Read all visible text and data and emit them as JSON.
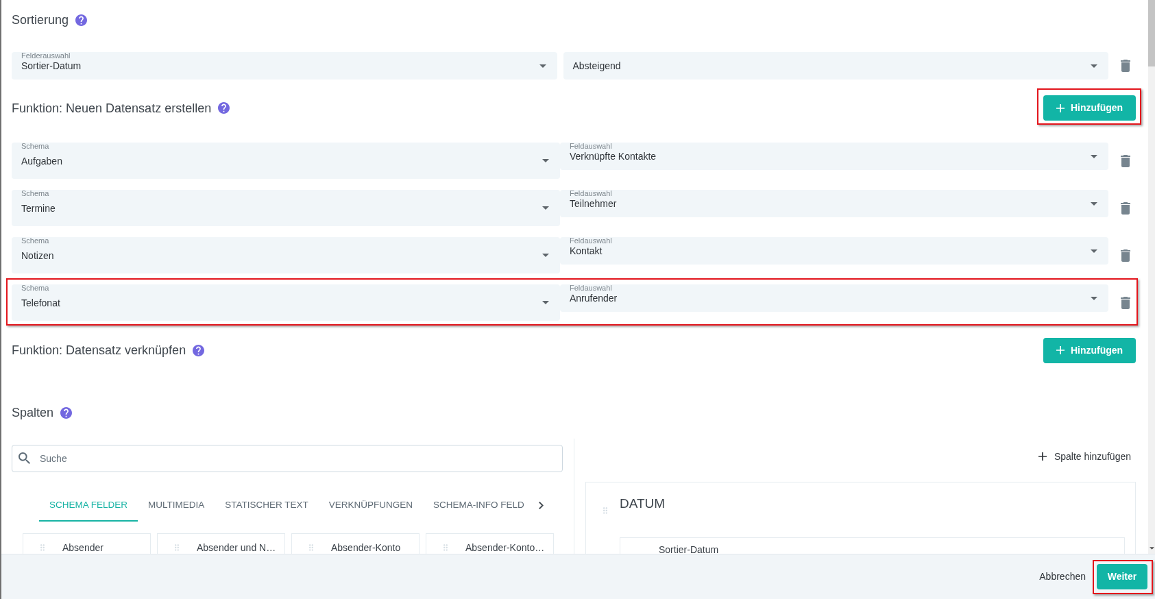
{
  "sorting": {
    "title": "Sortierung",
    "field": {
      "label": "Felderauswahl",
      "value": "Sortier-Datum"
    },
    "order": {
      "value": "Absteigend"
    }
  },
  "create_function": {
    "title": "Funktion: Neuen Datensatz erstellen",
    "add_button": {
      "label": "Hinzufügen",
      "highlighted": true
    },
    "rows": [
      {
        "schema_label": "Schema",
        "schema": "Aufgaben",
        "field_label": "Feldauswahl",
        "field": "Verknüpfte Kontakte",
        "highlighted": false
      },
      {
        "schema_label": "Schema",
        "schema": "Termine",
        "field_label": "Feldauswahl",
        "field": "Teilnehmer",
        "highlighted": false
      },
      {
        "schema_label": "Schema",
        "schema": "Notizen",
        "field_label": "Feldauswahl",
        "field": "Kontakt",
        "highlighted": false
      },
      {
        "schema_label": "Schema",
        "schema": "Telefonat",
        "field_label": "Feldauswahl",
        "field": "Anrufender",
        "highlighted": true
      }
    ]
  },
  "link_function": {
    "title": "Funktion: Datensatz verknüpfen",
    "add_button": {
      "label": "Hinzufügen",
      "highlighted": false
    }
  },
  "columns": {
    "title": "Spalten",
    "search": {
      "placeholder": "Suche"
    },
    "tabs": [
      {
        "label": "SCHEMA FELDER",
        "selected": true
      },
      {
        "label": "MULTIMEDIA",
        "selected": false
      },
      {
        "label": "STATISCHER TEXT",
        "selected": false
      },
      {
        "label": "VERKNÜPFUNGEN",
        "selected": false
      },
      {
        "label": "SCHEMA-INFO FELD",
        "selected": false
      }
    ],
    "fields": [
      "Absender",
      "Absender und N…",
      "Absender-Konto",
      "Absender-Konto…"
    ],
    "add_column": "Spalte hinzufügen",
    "column_cards": [
      {
        "title": "DATUM",
        "items": [
          "Sortier-Datum"
        ]
      }
    ]
  },
  "footer": {
    "cancel": "Abbrechen",
    "next": {
      "label": "Weiter",
      "highlighted": true
    }
  }
}
